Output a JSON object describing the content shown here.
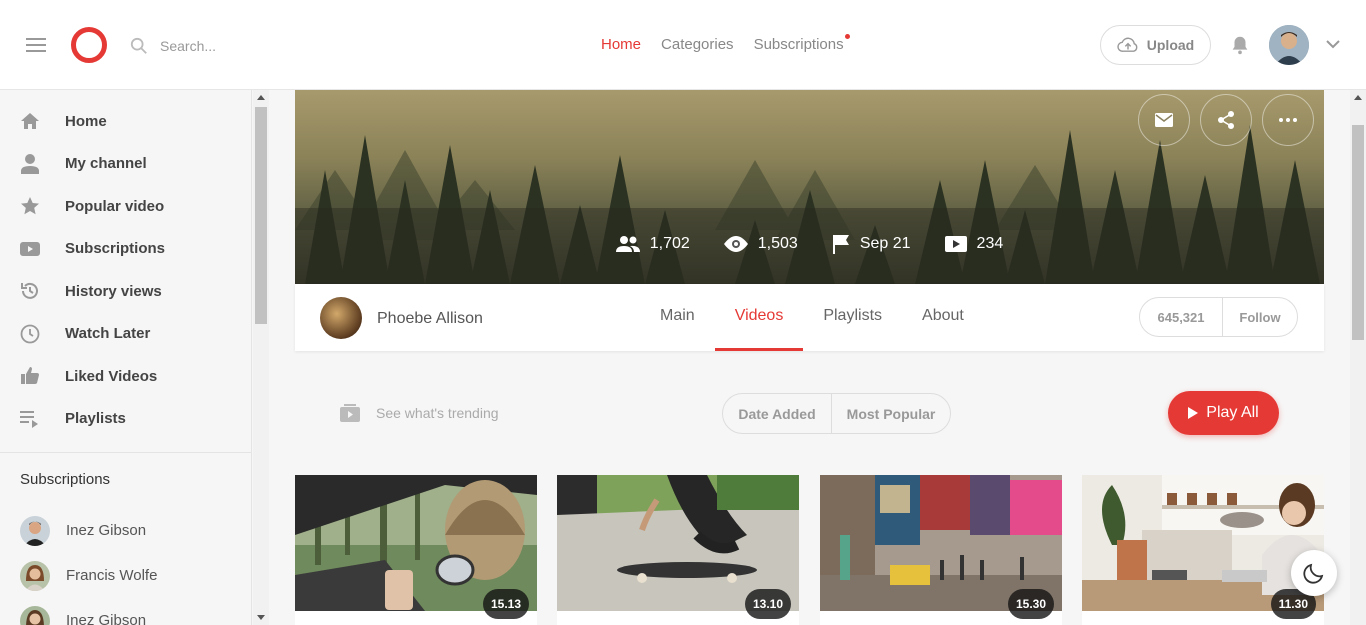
{
  "header": {
    "search_placeholder": "Search...",
    "nav": [
      {
        "label": "Home",
        "active": true
      },
      {
        "label": "Categories",
        "active": false
      },
      {
        "label": "Subscriptions",
        "active": false,
        "notification_dot": true
      }
    ],
    "upload_label": "Upload",
    "icons": {
      "menu": "hamburger-icon",
      "search": "search-icon",
      "upload": "cloud-upload-icon",
      "notifications": "bell-icon",
      "account": "chevron-down-icon"
    }
  },
  "sidebar": {
    "items": [
      {
        "label": "Home",
        "icon": "home-icon"
      },
      {
        "label": "My channel",
        "icon": "user-icon"
      },
      {
        "label": "Popular video",
        "icon": "star-icon"
      },
      {
        "label": "Subscriptions",
        "icon": "youtube-play-icon"
      },
      {
        "label": "History views",
        "icon": "history-icon"
      },
      {
        "label": "Watch Later",
        "icon": "clock-icon"
      },
      {
        "label": "Liked Videos",
        "icon": "thumbs-up-icon"
      },
      {
        "label": "Playlists",
        "icon": "playlist-icon"
      }
    ],
    "subscriptions_heading": "Subscriptions",
    "subscriptions": [
      {
        "name": "Inez Gibson"
      },
      {
        "name": "Francis Wolfe"
      },
      {
        "name": "Inez Gibson"
      }
    ]
  },
  "banner": {
    "stats": [
      {
        "icon": "people-icon",
        "value": "1,702"
      },
      {
        "icon": "eye-icon",
        "value": "1,503"
      },
      {
        "icon": "flag-icon",
        "value": "Sep 21"
      },
      {
        "icon": "video-icon",
        "value": "234"
      }
    ],
    "actions": [
      "mail-icon",
      "share-icon",
      "more-icon"
    ]
  },
  "channel": {
    "name": "Phoebe Allison",
    "tabs": [
      {
        "label": "Main",
        "active": false
      },
      {
        "label": "Videos",
        "active": true
      },
      {
        "label": "Playlists",
        "active": false
      },
      {
        "label": "About",
        "active": false
      }
    ],
    "follower_count": "645,321",
    "follow_label": "Follow"
  },
  "filters": {
    "trending_text": "See what's trending",
    "sort_options": [
      "Date Added",
      "Most Popular"
    ],
    "play_all_label": "Play All"
  },
  "videos": [
    {
      "duration": "15.13",
      "scene": "car-window"
    },
    {
      "duration": "13.10",
      "scene": "skateboard"
    },
    {
      "duration": "15.30",
      "scene": "times-square"
    },
    {
      "duration": "11.30",
      "scene": "woman-laptop"
    }
  ],
  "colors": {
    "accent": "#e53935",
    "text": "#333333",
    "muted": "#999999",
    "background": "#f6f6f6"
  }
}
